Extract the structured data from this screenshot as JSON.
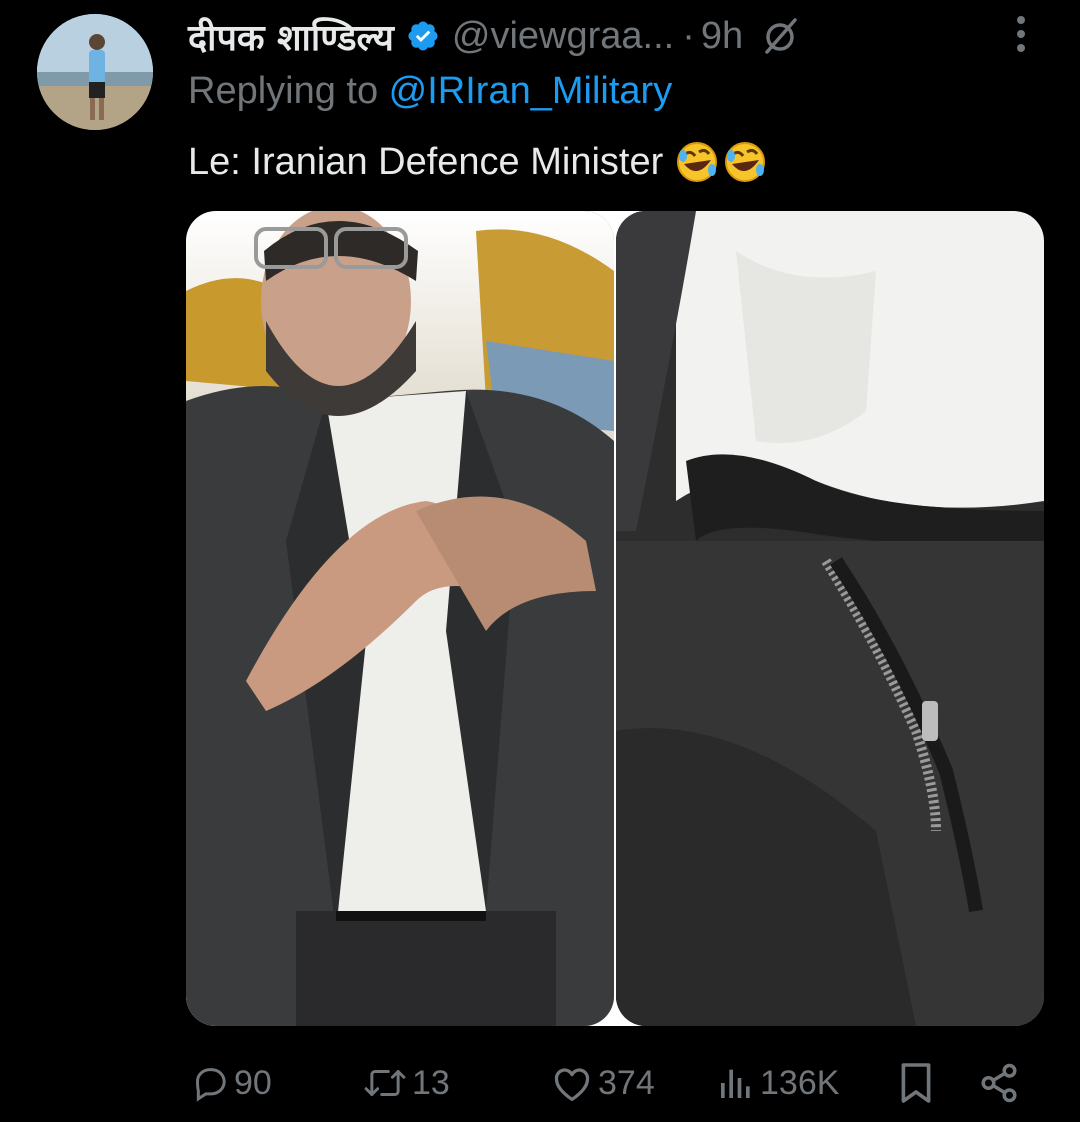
{
  "tweet": {
    "display_name": "दीपक शाण्डिल्य",
    "handle": "@viewgraa...",
    "separator": "·",
    "time": "9h",
    "replying_prefix": "Replying to ",
    "replying_to": "@IRIran_Military",
    "text": "Le: Iranian Defence Minister"
  },
  "icons": {
    "verified": "verified-badge-icon",
    "grok": "grok-icon",
    "more": "more-vertical-icon",
    "emoji": "rolling-on-floor-laughing-emoji",
    "reply": "reply-icon",
    "retweet": "retweet-icon",
    "like": "like-icon",
    "views": "views-icon",
    "bookmark": "bookmark-icon",
    "share": "share-icon"
  },
  "media": {
    "left_image": "man-in-suit-photo",
    "right_image": "open-trouser-zipper-photo"
  },
  "actions": {
    "replies": "90",
    "retweets": "13",
    "likes": "374",
    "views": "136K"
  },
  "colors": {
    "background": "#000000",
    "text": "#e7e9ea",
    "muted": "#71767b",
    "accent": "#1d9bf0"
  }
}
